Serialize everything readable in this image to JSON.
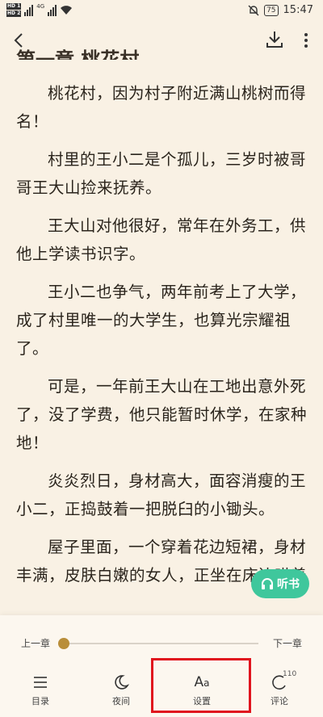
{
  "status_bar": {
    "sim1": "HD 1",
    "sim2": "HD 2",
    "network": "4G",
    "battery": "75",
    "time": "15:47"
  },
  "title_partial": "第一章 桃花村",
  "paragraphs": [
    "桃花村，因为村子附近满山桃树而得名！",
    "村里的王小二是个孤儿，三岁时被哥哥王大山捡来抚养。",
    "王大山对他很好，常年在外务工，供他上学读书识字。",
    "王小二也争气，两年前考上了大学，成了村里唯一的大学生，也算光宗耀祖了。",
    "可是，一年前王大山在工地出意外死了，没了学费，他只能暂时休学，在家种地！",
    "炎炎烈日，身材高大，面容消瘦的王小二，正捣鼓着一把脱臼的小锄头。",
    "屋子里面，一个穿着花边短裙，身材丰满，皮肤白嫩的女人，正坐在床边哄着"
  ],
  "listen_button": {
    "label": "听书",
    "icon": "headphones-icon"
  },
  "chapter_nav": {
    "prev_label": "上一章",
    "next_label": "下一章",
    "progress": 0.0
  },
  "bottom_nav": {
    "items": [
      {
        "label": "目录",
        "icon": "list-icon"
      },
      {
        "label": "夜间",
        "icon": "moon-icon"
      },
      {
        "label": "设置",
        "icon": "font-settings-icon"
      },
      {
        "label": "评论",
        "icon": "comment-icon",
        "badge": "110"
      }
    ]
  },
  "colors": {
    "background": "#f9f1e4",
    "accent_green": "#3fc79c",
    "slider_thumb": "#b98e3a",
    "highlight_red": "#e0141e"
  }
}
